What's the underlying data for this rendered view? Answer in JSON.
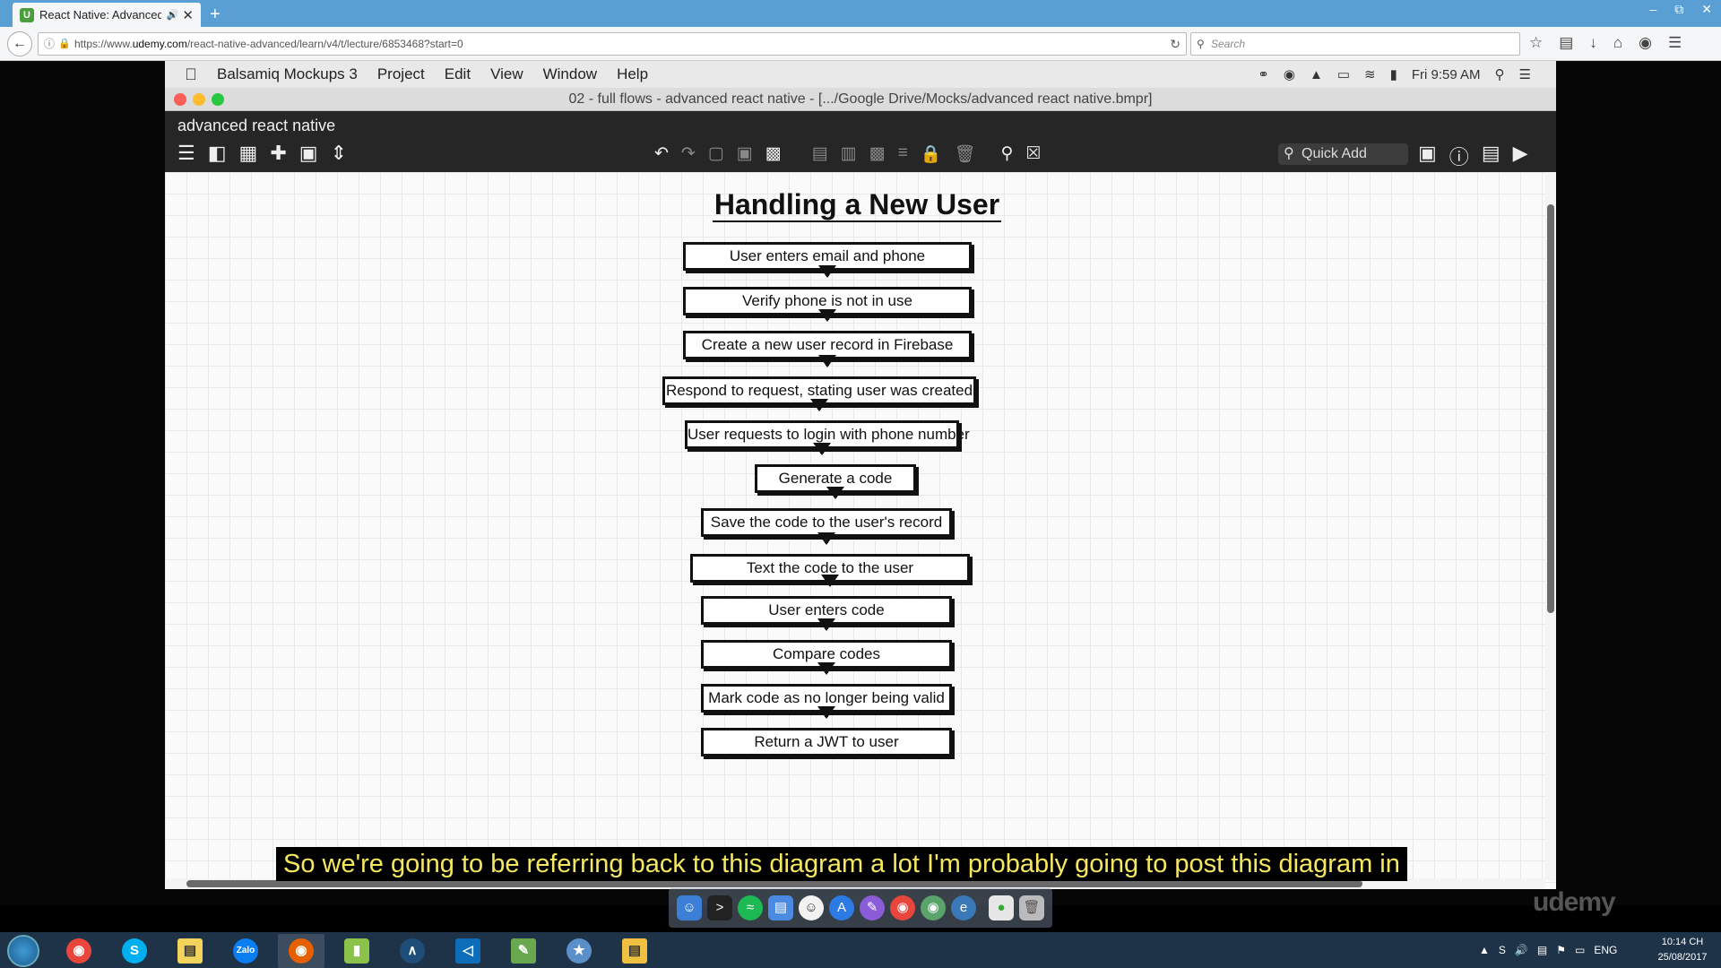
{
  "browser": {
    "tab_title": "React Native: Advanced",
    "new_tab": "+",
    "url_prefix": "https://www.",
    "url_domain": "udemy.com",
    "url_path": "/react-native-advanced/learn/v4/t/lecture/6853468?start=0",
    "search_placeholder": "Search"
  },
  "mac": {
    "app_name": "Balsamiq Mockups 3",
    "menu": [
      "Project",
      "Edit",
      "View",
      "Window",
      "Help"
    ],
    "clock": "Fri 9:59 AM"
  },
  "window": {
    "title": "02 - full flows - advanced react native - [.../Google Drive/Mocks/advanced react native.bmpr]"
  },
  "balsamiq": {
    "project_name": "advanced react native",
    "quick_add": "Quick Add"
  },
  "flow": {
    "title": "Handling a New User",
    "steps": [
      "User enters email and phone",
      "Verify phone is not in use",
      "Create a new user record in Firebase",
      "Respond to request, stating user was created",
      "User requests to login with phone number",
      "Generate a code",
      "Save the code to the user's record",
      "Text the code to the user",
      "User enters code",
      "Compare codes",
      "Mark code as no longer being valid",
      "Return a JWT to user"
    ]
  },
  "caption": "So we're going to be referring back to this diagram a lot I'm probably going to post this diagram in",
  "watermark": "udemy",
  "taskbar": {
    "language": "ENG",
    "time": "10:14 CH",
    "date": "25/08/2017"
  },
  "colors": {
    "browser_tabbar": "#5a9fd4",
    "balsamiq_toolbar": "#262626",
    "caption_text": "#f5e860",
    "taskbar": "#1f3348"
  }
}
